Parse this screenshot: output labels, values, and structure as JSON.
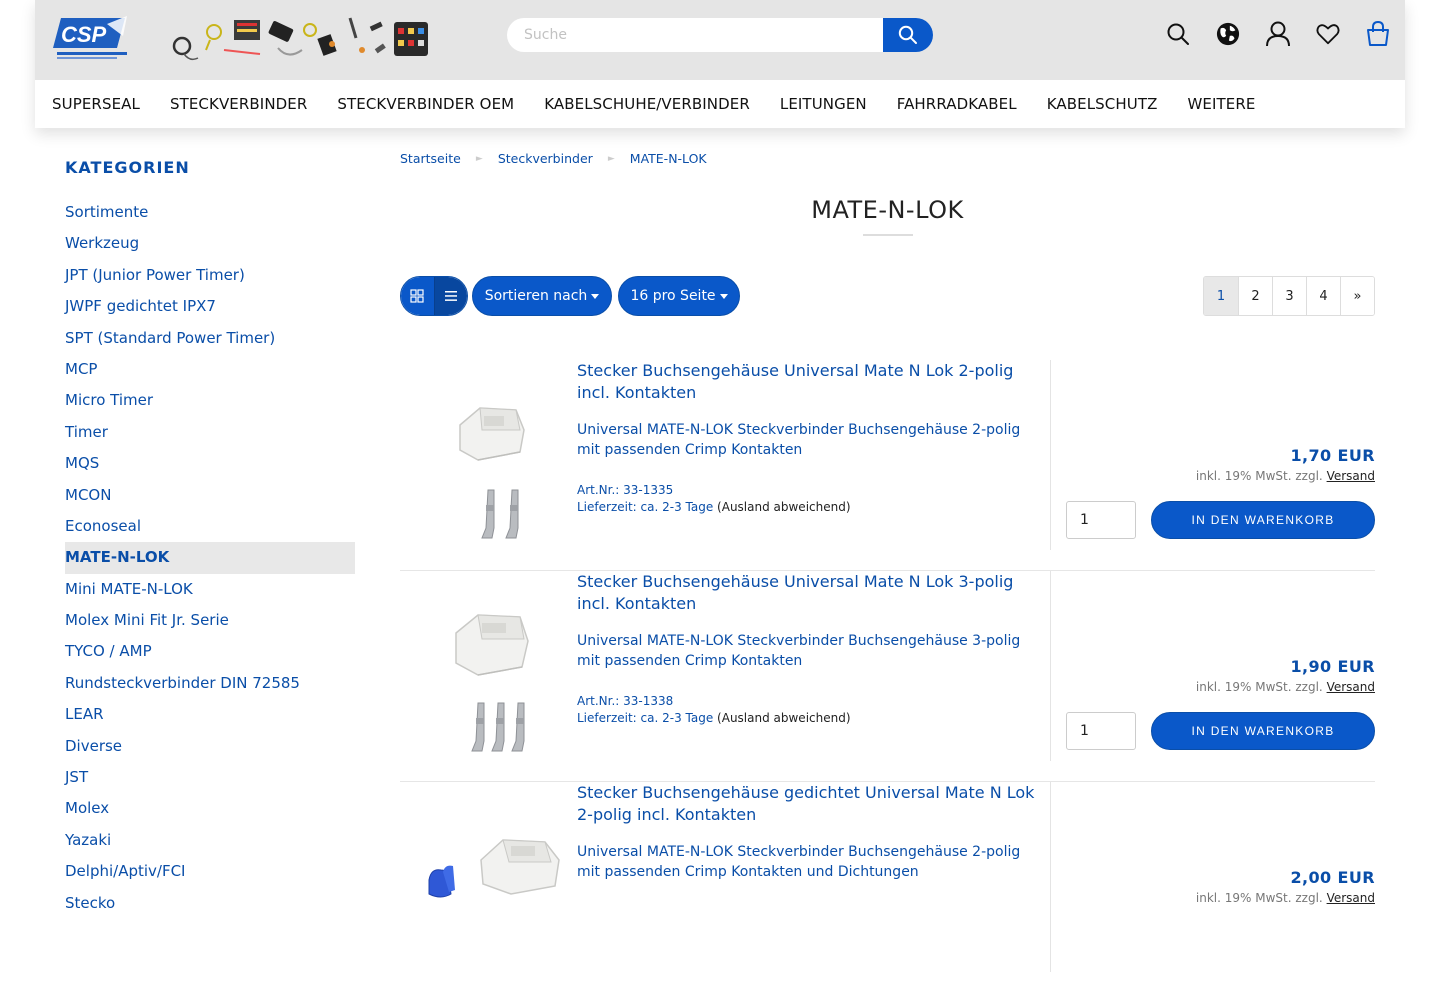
{
  "header": {
    "search_placeholder": "Suche",
    "nav": [
      "SUPERSEAL",
      "STECKVERBINDER",
      "STECKVERBINDER OEM",
      "KABELSCHUHE/VERBINDER",
      "LEITUNGEN",
      "FAHRRADKABEL",
      "KABELSCHUTZ",
      "WEITERE"
    ],
    "icons": [
      "search-icon",
      "globe-icon",
      "user-icon",
      "heart-icon",
      "shopping-bag-icon"
    ]
  },
  "sidebar": {
    "title": "KATEGORIEN",
    "items": [
      "Sortimente",
      "Werkzeug",
      "JPT (Junior Power Timer)",
      "JWPF gedichtet IPX7",
      "SPT (Standard Power Timer)",
      "MCP",
      "Micro Timer",
      "Timer",
      "MQS",
      "MCON",
      "Econoseal",
      "MATE-N-LOK",
      "Mini MATE-N-LOK",
      "Molex Mini Fit Jr. Serie",
      "TYCO / AMP",
      "Rundsteckverbinder DIN 72585",
      "LEAR",
      "Diverse",
      "JST",
      "Molex",
      "Yazaki",
      "Delphi/Aptiv/FCI",
      "Stecko"
    ],
    "active_item": "MATE-N-LOK"
  },
  "breadcrumb": [
    "Startseite",
    "Steckverbinder",
    "MATE-N-LOK"
  ],
  "page_title": "MATE-N-LOK",
  "toolbar": {
    "sort_label": "Sortieren nach",
    "per_page_label": "16 pro Seite",
    "pages": [
      "1",
      "2",
      "3",
      "4",
      "»"
    ],
    "active_page": "1"
  },
  "products": [
    {
      "title": "Stecker Buchsengehäuse Universal Mate N Lok 2-polig incl. Kontakten",
      "desc": "Universal MATE-N-LOK Steckverbinder Buchsengehäuse 2-polig mit passenden Crimp Kontakten",
      "art": "Art.Nr.: 33-1335",
      "delivery": "Lieferzeit: ca. 2-3 Tage",
      "delivery_note": "(Ausland abweichend)",
      "price": "1,70 EUR",
      "vat": "inkl. 19% MwSt. zzgl.",
      "shipping": "Versand",
      "qty": "1",
      "button": "IN DEN WARENKORB"
    },
    {
      "title": "Stecker Buchsengehäuse Universal Mate N Lok 3-polig incl. Kontakten",
      "desc": "Universal MATE-N-LOK Steckverbinder Buchsengehäuse 3-polig mit passenden Crimp Kontakten",
      "art": "Art.Nr.: 33-1338",
      "delivery": "Lieferzeit: ca. 2-3 Tage",
      "delivery_note": "(Ausland abweichend)",
      "price": "1,90 EUR",
      "vat": "inkl. 19% MwSt. zzgl.",
      "shipping": "Versand",
      "qty": "1",
      "button": "IN DEN WARENKORB"
    },
    {
      "title": "Stecker Buchsengehäuse gedichtet Universal Mate N Lok 2-polig incl. Kontakten",
      "desc": "Universal MATE-N-LOK Steckverbinder Buchsengehäuse 2-polig mit passenden Crimp Kontakten und Dichtungen",
      "price": "2,00 EUR",
      "vat": "inkl. 19% MwSt. zzgl.",
      "shipping": "Versand"
    }
  ],
  "colors": {
    "accent": "#0a58c9",
    "link": "#0a4ea8",
    "topbar": "#e5e5e5"
  }
}
